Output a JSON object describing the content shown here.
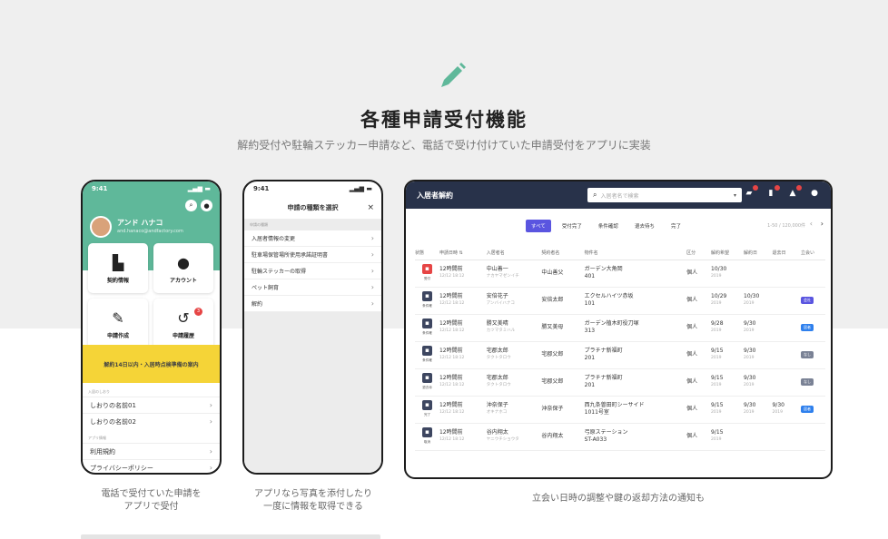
{
  "hero": {
    "title": "各種申請受付機能",
    "subtitle": "解約受付や駐輪ステッカー申請など、電話で受け付けていた申請受付をアプリに実装"
  },
  "phone1": {
    "time": "9:41",
    "user_name": "アンド ハナコ",
    "user_email": "and.hanaco@andfactory.com",
    "tiles": [
      {
        "label": "契約情報",
        "icon": "building-icon"
      },
      {
        "label": "アカウント",
        "icon": "user-circle-icon"
      },
      {
        "label": "申請作成",
        "icon": "pencil-icon"
      },
      {
        "label": "申請履歴",
        "icon": "history-icon",
        "badge": "3"
      }
    ],
    "banner": "解約14日以内・入居時点検準備の案内",
    "section1": "入居のしおり",
    "guides": [
      "しおりの名前01",
      "しおりの名前02"
    ],
    "section2": "アプリ情報",
    "info": [
      "利用規約",
      "プライバシーポリシー"
    ]
  },
  "phone2": {
    "time": "9:41",
    "title": "申請の種類を選択",
    "close": "×",
    "group": "申請の種類",
    "items": [
      "入居者情報の変更",
      "駐車場保管場所使用承諾証明書",
      "駐輪ステッカーの取得",
      "ペット飼育",
      "解約"
    ]
  },
  "captions": {
    "phone1": [
      "電話で受付ていた申請を",
      "アプリで受付"
    ],
    "phone2": [
      "アプリなら写真を添付したり",
      "一度に情報を取得できる"
    ],
    "desktop": "立会い日時の調整や鍵の返却方法の通知も"
  },
  "desktop": {
    "title": "入居者解約",
    "search_placeholder": "入居者名で検索",
    "filters": [
      "すべて",
      "受付完了",
      "条件確認",
      "退去待ち",
      "完了"
    ],
    "pager": "1-50 / 120,000件",
    "columns": [
      "状態",
      "申請日時 ⇅",
      "入居者名",
      "契約者名",
      "物件名",
      "区分",
      "解約希望",
      "解約日",
      "退去日",
      "立会い"
    ],
    "rows": [
      {
        "status": "受付",
        "status_color": "#e64545",
        "date": "12時間前",
        "date_sub": "12/12 18:12",
        "name": "中山善一",
        "kana": "ナカヤマゼンイチ",
        "contractor": "中山善父",
        "building": "ガーデン大角岡",
        "room": "401",
        "kubun": "個人",
        "wish": "10/30",
        "wish_y": "2019",
        "end": "",
        "end_y": "",
        "out": "",
        "out_y": "",
        "tag": "",
        "tag_color": ""
      },
      {
        "status": "条件確",
        "status_color": "#3d4660",
        "date": "12時間前",
        "date_sub": "12/12 18:12",
        "name": "安倍花子",
        "kana": "アンバイハナコ",
        "contractor": "安倍太郎",
        "building": "エクセルハイツ赤坂",
        "room": "101",
        "kubun": "個人",
        "wish": "10/29",
        "wish_y": "2019",
        "end": "10/30",
        "end_y": "2019",
        "out": "",
        "out_y": "",
        "tag": "会社",
        "tag_color": "#5a55e0"
      },
      {
        "status": "条件確",
        "status_color": "#3d4660",
        "date": "12時間前",
        "date_sub": "12/12 18:12",
        "name": "勝又美晴",
        "kana": "カツマタミハル",
        "contractor": "勝又美母",
        "building": "ガーデン植木町役刀塚",
        "room": "313",
        "kubun": "個人",
        "wish": "9/28",
        "wish_y": "2019",
        "end": "9/30",
        "end_y": "2019",
        "out": "",
        "out_y": "",
        "tag": "居者",
        "tag_color": "#2f80ed"
      },
      {
        "status": "条件確",
        "status_color": "#3d4660",
        "date": "12時間前",
        "date_sub": "12/12 18:12",
        "name": "宅郡太郎",
        "kana": "タクトタロウ",
        "contractor": "宅郡父郎",
        "building": "プラチナ新福町",
        "room": "201",
        "kubun": "個人",
        "wish": "9/15",
        "wish_y": "2019",
        "end": "9/30",
        "end_y": "2019",
        "out": "",
        "out_y": "",
        "tag": "なし",
        "tag_color": "#7a8295"
      },
      {
        "status": "退去待",
        "status_color": "#3d4660",
        "date": "12時間前",
        "date_sub": "12/12 18:12",
        "name": "宅郡太郎",
        "kana": "タクトタロウ",
        "contractor": "宅郡父郎",
        "building": "プラチナ新福町",
        "room": "201",
        "kubun": "個人",
        "wish": "9/15",
        "wish_y": "2019",
        "end": "9/30",
        "end_y": "2019",
        "out": "",
        "out_y": "",
        "tag": "なし",
        "tag_color": "#7a8295"
      },
      {
        "status": "完了",
        "status_color": "#3d4660",
        "date": "12時間前",
        "date_sub": "12/12 18:12",
        "name": "沖奈保子",
        "kana": "オキナホコ",
        "contractor": "沖奈保子",
        "building": "西九条曽田町シーサイド",
        "room": "1011号室",
        "kubun": "個人",
        "wish": "9/15",
        "wish_y": "2019",
        "end": "9/30",
        "end_y": "2019",
        "out": "9/30",
        "out_y": "2019",
        "tag": "居者",
        "tag_color": "#2f80ed"
      },
      {
        "status": "取消",
        "status_color": "#3d4660",
        "date": "12時間前",
        "date_sub": "12/12 18:12",
        "name": "谷内翔太",
        "kana": "ヤニウチショウタ",
        "contractor": "谷内翔太",
        "building": "弓原ステーション",
        "room": "ST-A033",
        "kubun": "個人",
        "wish": "9/15",
        "wish_y": "2019",
        "end": "",
        "end_y": "",
        "out": "",
        "out_y": "",
        "tag": "",
        "tag_color": ""
      }
    ]
  },
  "colors": {
    "green": "#5fb89a",
    "yellow": "#f5d437",
    "nav": "#28324a",
    "accent": "#5a55e0"
  }
}
